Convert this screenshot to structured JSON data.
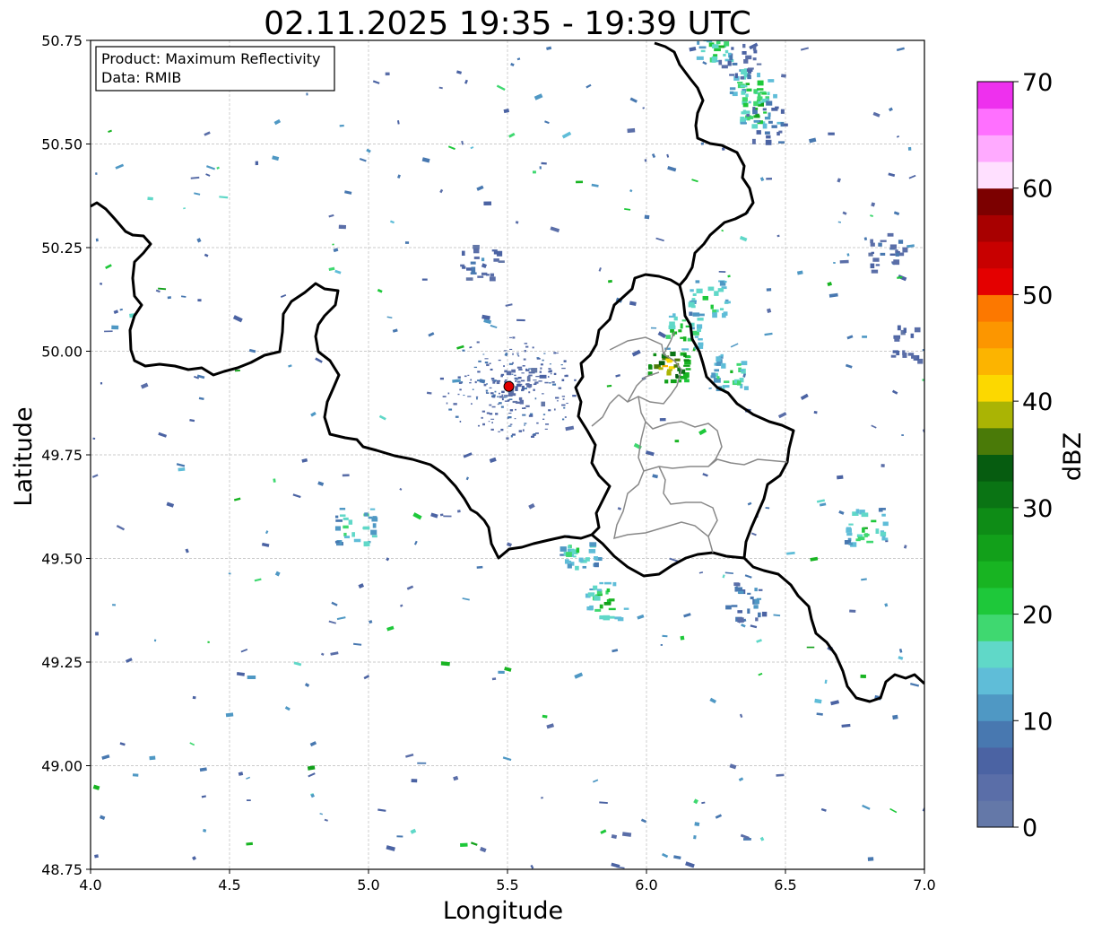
{
  "chart_data": {
    "type": "heatmap",
    "title": "02.11.2025 19:35 - 19:39 UTC",
    "xlabel": "Longitude",
    "ylabel": "Latitude",
    "xlim": [
      4.0,
      7.0
    ],
    "ylim": [
      48.75,
      50.75
    ],
    "x_ticks": [
      "4.0",
      "4.5",
      "5.0",
      "5.5",
      "6.0",
      "6.5",
      "7.0"
    ],
    "y_ticks": [
      "48.75",
      "49.00",
      "49.25",
      "49.50",
      "49.75",
      "50.00",
      "50.25",
      "50.50",
      "50.75"
    ],
    "grid": true,
    "info_box": {
      "product": "Product: Maximum Reflectivity",
      "data": "Data: RMIB"
    },
    "radar_site": {
      "lon": 5.505,
      "lat": 49.915,
      "color": "#e00000"
    },
    "colorbar": {
      "label": "dBZ",
      "min": 0,
      "max": 70,
      "ticks": [
        "0",
        "10",
        "20",
        "30",
        "40",
        "50",
        "60",
        "70"
      ],
      "colors": [
        "#6478a8",
        "#5a6ea8",
        "#4b63a3",
        "#4878b0",
        "#4f98c4",
        "#5fbdd8",
        "#60d8c8",
        "#3fd870",
        "#1ec83a",
        "#18b422",
        "#12a01a",
        "#0e8c16",
        "#0a7414",
        "#065c10",
        "#4a7a08",
        "#aab404",
        "#fcd800",
        "#fcb400",
        "#fc9600",
        "#fc7800",
        "#e40000",
        "#c80000",
        "#a80000",
        "#7c0000",
        "#ffe0ff",
        "#ffaaff",
        "#ff70ff",
        "#ee30ee"
      ]
    },
    "echo_cells": [
      {
        "lon": 6.4,
        "lat": 50.59,
        "dbz": 28
      },
      {
        "lon": 6.37,
        "lat": 50.64,
        "dbz": 24
      },
      {
        "lon": 6.42,
        "lat": 50.55,
        "dbz": 12
      },
      {
        "lon": 6.25,
        "lat": 50.73,
        "dbz": 22
      },
      {
        "lon": 6.33,
        "lat": 50.7,
        "dbz": 8
      },
      {
        "lon": 6.85,
        "lat": 50.25,
        "dbz": 8
      },
      {
        "lon": 6.95,
        "lat": 50.02,
        "dbz": 8
      },
      {
        "lon": 6.12,
        "lat": 50.05,
        "dbz": 26
      },
      {
        "lon": 6.07,
        "lat": 49.97,
        "dbz": 45
      },
      {
        "lon": 6.3,
        "lat": 49.95,
        "dbz": 22
      },
      {
        "lon": 6.22,
        "lat": 50.13,
        "dbz": 24
      },
      {
        "lon": 5.4,
        "lat": 50.22,
        "dbz": 8
      },
      {
        "lon": 5.55,
        "lat": 49.92,
        "dbz": 6
      },
      {
        "lon": 5.85,
        "lat": 49.4,
        "dbz": 25
      },
      {
        "lon": 5.75,
        "lat": 49.52,
        "dbz": 20
      },
      {
        "lon": 6.35,
        "lat": 49.4,
        "dbz": 12
      },
      {
        "lon": 4.95,
        "lat": 49.58,
        "dbz": 22
      },
      {
        "lon": 6.78,
        "lat": 49.58,
        "dbz": 24
      }
    ]
  }
}
